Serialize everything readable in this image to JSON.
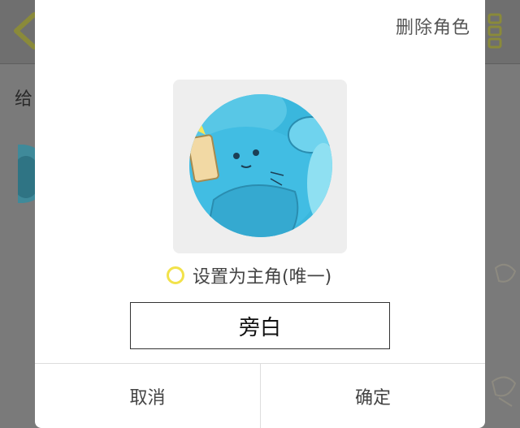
{
  "background": {
    "label": "给",
    "back_icon": "chevron-left-icon",
    "menu_icon": "list-menu-icon"
  },
  "dialog": {
    "delete_role": "删除角色",
    "avatar_icon": "seal-avatar-image",
    "main_role_label": "设置为主角(唯一)",
    "main_role_checked": false,
    "name_value": "旁白",
    "cancel_label": "取消",
    "confirm_label": "确定"
  },
  "colors": {
    "radio_ring": "#f2e24a",
    "avatar_blue": "#3ab7dd"
  }
}
